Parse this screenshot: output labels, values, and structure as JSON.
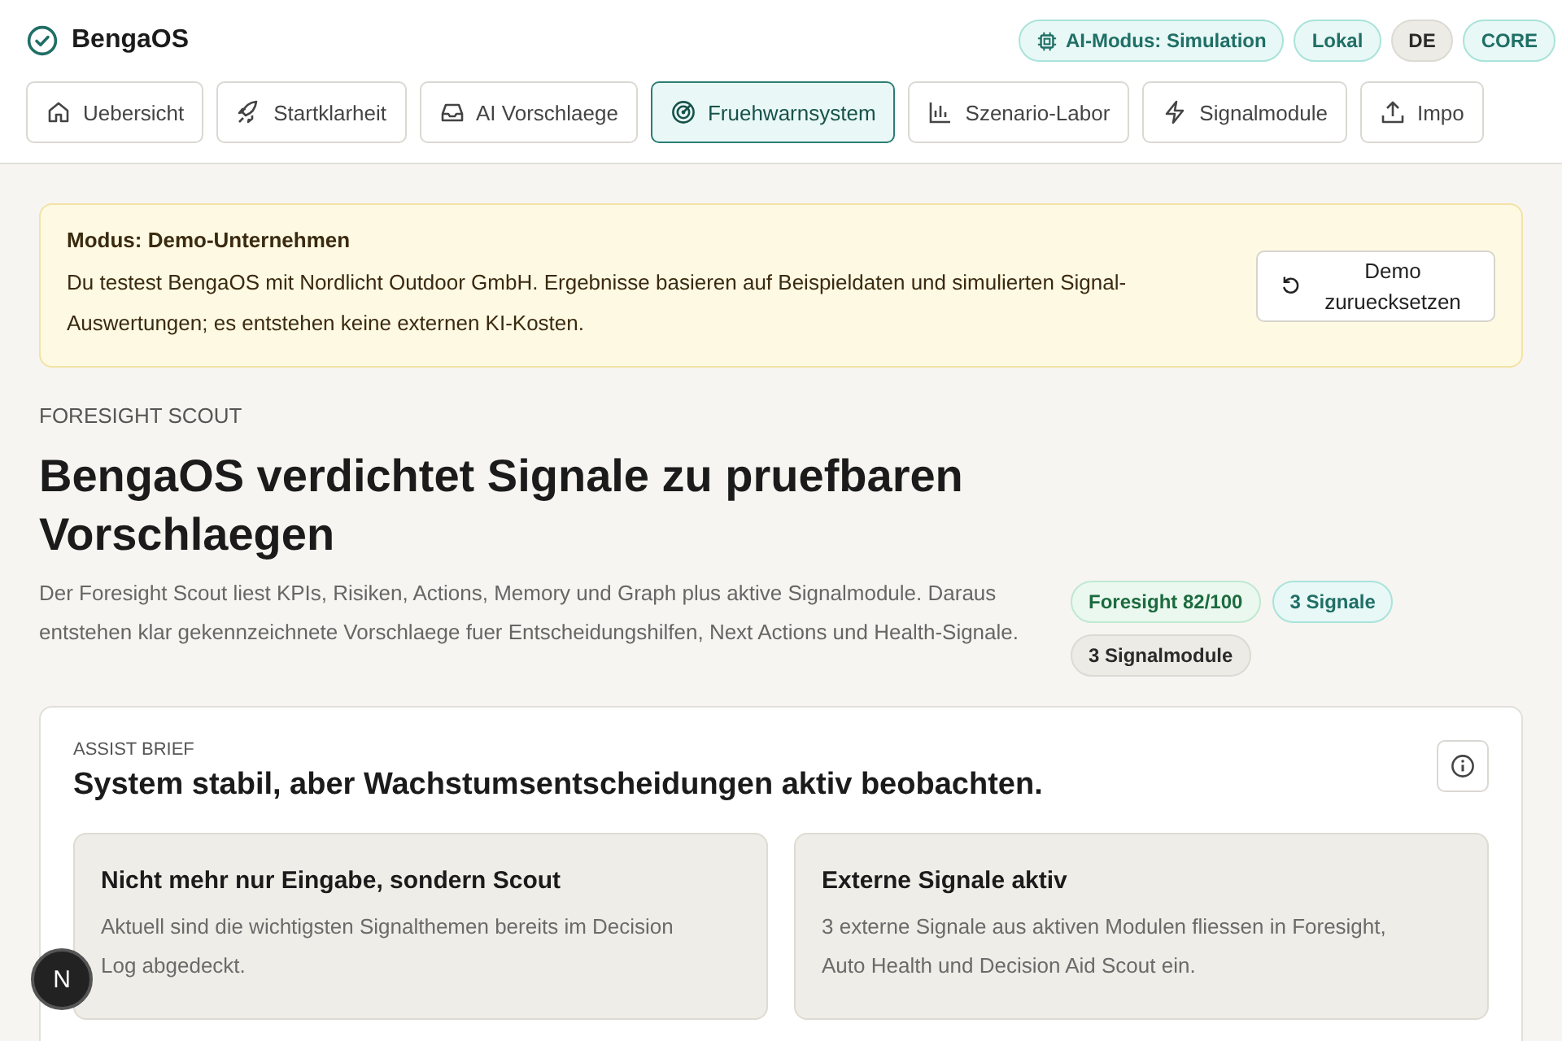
{
  "app": {
    "title": "BengaOS"
  },
  "header_badges": [
    {
      "label": "AI-Modus: Simulation",
      "kind": "mode"
    },
    {
      "label": "Lokal",
      "kind": "accent"
    },
    {
      "label": "DE",
      "kind": "neutral"
    },
    {
      "label": "CORE",
      "kind": "accent"
    }
  ],
  "tabs": [
    {
      "label": "Uebersicht",
      "selected": false
    },
    {
      "label": "Startklarheit",
      "selected": false
    },
    {
      "label": "AI Vorschlaege",
      "selected": false
    },
    {
      "label": "Fruehwarnsystem",
      "selected": true
    },
    {
      "label": "Szenario-Labor",
      "selected": false
    },
    {
      "label": "Signalmodule",
      "selected": false
    },
    {
      "label": "Impo",
      "selected": false
    }
  ],
  "demo_banner": {
    "title": "Modus: Demo-Unternehmen",
    "text": "Du testest BengaOS mit Nordlicht Outdoor GmbH. Ergebnisse basieren auf Beispieldaten und simulierten Signal-Auswertungen; es entstehen keine externen KI-Kosten.",
    "button": "Demo zuruecksetzen"
  },
  "hero": {
    "eyebrow": "FORESIGHT SCOUT",
    "title": "BengaOS verdichtet Signale zu pruefbaren Vorschlaegen",
    "text": "Der Foresight Scout liest KPIs, Risiken, Actions, Memory und Graph plus aktive Signalmodule. Daraus entstehen klar gekennzeichnete Vorschlaege fuer Entscheidungshilfen, Next Actions und Health-Signale.",
    "badges": [
      {
        "label": "Foresight 82/100",
        "kind": "positive"
      },
      {
        "label": "3 Signale",
        "kind": "accent"
      },
      {
        "label": "3 Signalmodule",
        "kind": "neutral"
      }
    ]
  },
  "assist_brief": {
    "eyebrow": "ASSIST BRIEF",
    "title": "System stabil, aber Wachstumsentscheidungen aktiv beobachten.",
    "cards": [
      {
        "title": "Nicht mehr nur Eingabe, sondern Scout",
        "text": "Aktuell sind die wichtigsten Signalthemen bereits im Decision Log abgedeckt."
      },
      {
        "title": "Externe Signale aktiv",
        "text": "3 externe Signale aus aktiven Modulen fliessen in Foresight, Auto Health und Decision Aid Scout ein."
      }
    ]
  },
  "dev_indicator": {
    "label": "N"
  }
}
